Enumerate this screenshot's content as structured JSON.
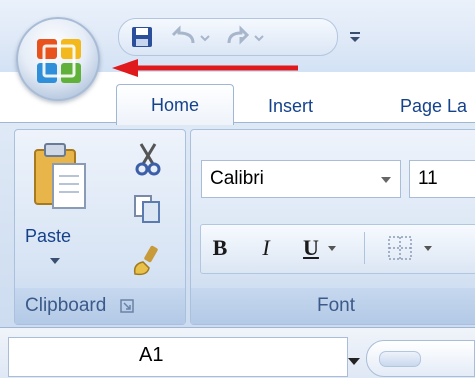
{
  "qat": {
    "save_icon": "save-icon",
    "undo_icon": "undo-icon",
    "redo_icon": "redo-icon",
    "customize_icon": "customize-qat-icon"
  },
  "tabs": [
    {
      "label": "Home",
      "active": true
    },
    {
      "label": "Insert",
      "active": false
    },
    {
      "label": "Page La",
      "active": false
    }
  ],
  "clipboard": {
    "paste_label": "Paste",
    "group_label": "Clipboard"
  },
  "font": {
    "font_name": "Calibri",
    "font_size": "11",
    "bold": "B",
    "italic": "I",
    "underline": "U",
    "group_label": "Font"
  },
  "formula_bar": {
    "name_box_value": "A1"
  },
  "colors": {
    "accent": "#15428b",
    "arrow": "#e0191c"
  }
}
